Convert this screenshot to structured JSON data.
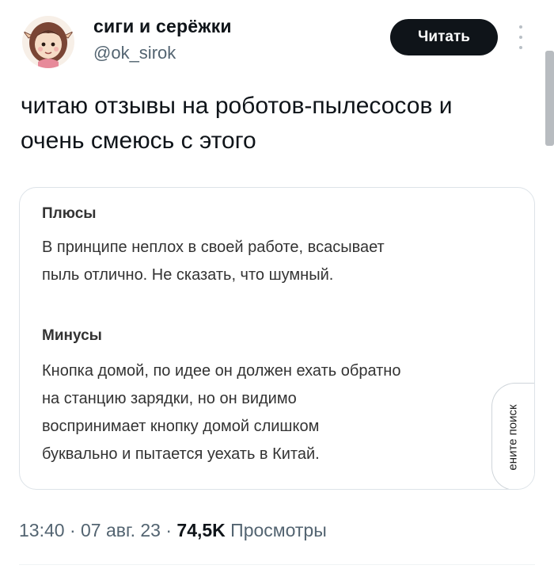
{
  "author": {
    "display_name": "сиги и серёжки",
    "handle": "@ok_sirok"
  },
  "follow_button": {
    "label": "Читать"
  },
  "tweet": {
    "line1": "читаю отзывы на роботов-пылесосов и",
    "line2": "очень смеюсь с этого"
  },
  "review_card": {
    "pros_title": "Плюсы",
    "pros_line1": "В принципе неплох в своей работе, всасывает",
    "pros_line2": "пыль отлично. Не сказать, что шумный.",
    "cons_title": "Минусы",
    "cons_line1": "Кнопка домой, по идее он должен ехать обратно",
    "cons_line2": "на станцию зарядки, но он видимо",
    "cons_line3": "воспринимает кнопку домой слишком",
    "cons_line4": "буквально и пытается уехать в Китай.",
    "side_tab_label": "ените поиск"
  },
  "meta": {
    "time": "13:40",
    "date": "07 авг. 23",
    "separator": "·",
    "views_count": "74,5K",
    "views_label": "Просмотры"
  },
  "colors": {
    "text_primary": "#0f1419",
    "text_secondary": "#536471",
    "button_bg": "#0f1419",
    "card_border": "#dde3e8"
  },
  "icons": {
    "more": "more-vertical-icon",
    "avatar": "girl-avatar"
  }
}
